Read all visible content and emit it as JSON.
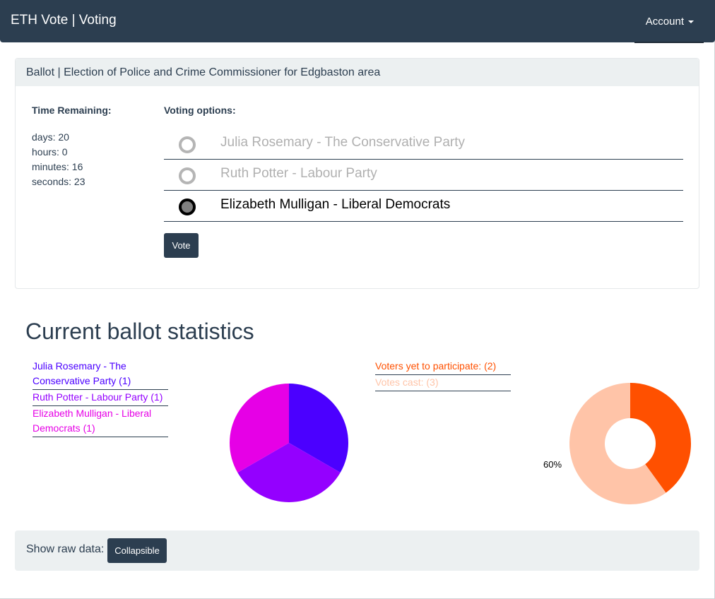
{
  "navbar": {
    "brand": "ETH Vote | Voting",
    "account_label": "Account"
  },
  "ballot": {
    "header": "Ballot | Election of Police and Crime Commissioner for Edgbaston area",
    "time_heading": "Time Remaining:",
    "time": {
      "days": "days: 20",
      "hours": "hours: 0",
      "minutes": "minutes: 16",
      "seconds": "seconds: 23"
    },
    "options_heading": "Voting options:",
    "options": [
      {
        "label": "Julia Rosemary - The Conservative Party",
        "selected": false
      },
      {
        "label": "Ruth Potter - Labour Party",
        "selected": false
      },
      {
        "label": "Elizabeth Mulligan - Liberal Democrats",
        "selected": true
      }
    ],
    "vote_label": "Vote"
  },
  "stats": {
    "title": "Current ballot statistics",
    "candidates_legend": [
      {
        "label": "Julia Rosemary - The Conservative Party (1)",
        "color": "#4b00ff"
      },
      {
        "label": "Ruth Potter - Labour Party (1)",
        "color": "#9400ff"
      },
      {
        "label": "Elizabeth Mulligan - Liberal Democrats (1)",
        "color": "#e600e6"
      }
    ],
    "participation_legend": [
      {
        "label": "Voters yet to participate: (2)",
        "color": "#ff5000"
      },
      {
        "label": "Votes cast: (3)",
        "color": "#ffc4a8"
      }
    ],
    "donut_label": "60%"
  },
  "chart_data": [
    {
      "type": "pie",
      "categories": [
        "Julia Rosemary - The Conservative Party",
        "Ruth Potter - Labour Party",
        "Elizabeth Mulligan - Liberal Democrats"
      ],
      "values": [
        1,
        1,
        1
      ],
      "colors": [
        "#4b00ff",
        "#9400ff",
        "#e600e6"
      ]
    },
    {
      "type": "pie",
      "donut": true,
      "categories": [
        "Voters yet to participate",
        "Votes cast"
      ],
      "values": [
        2,
        3
      ],
      "colors": [
        "#ff5000",
        "#ffc4a8"
      ],
      "annotation": "60%"
    }
  ],
  "raw": {
    "label": "Show raw data:",
    "button_label": "Collapsible"
  }
}
